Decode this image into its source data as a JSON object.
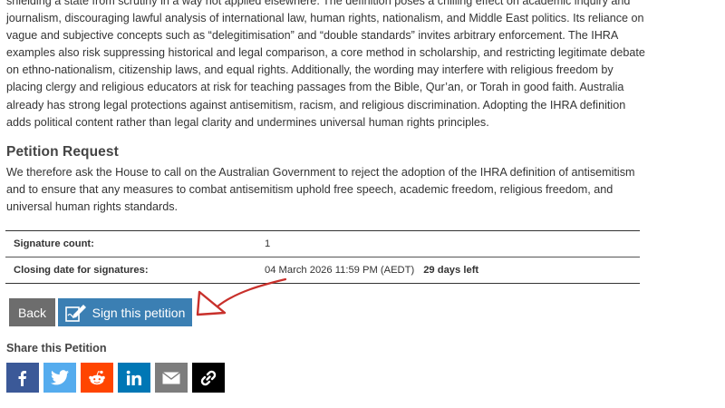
{
  "intro_paragraph": "shielding a state from scrutiny in a way not applied elsewhere. The definition poses a chilling effect on academic inquiry and journalism, discouraging lawful analysis of international law, human rights, nationalism, and Middle East politics. Its reliance on vague and subjective concepts such as “delegitimisation” and “double standards” invites arbitrary enforcement. The IHRA examples also risk suppressing historical and legal comparison, a core method in scholarship, and restricting legitimate debate on ethno-nationalism, citizenship laws, and equal rights. Additionally, the wording may interfere with religious freedom by placing clergy and religious educators at risk for teaching passages from the Bible, Qur’an, or Torah in good faith. Australia already has strong legal protections against antisemitism, racism, and religious discrimination. Adopting the IHRA definition adds political content rather than legal clarity and undermines universal human rights principles.",
  "petition_request": {
    "heading": "Petition Request",
    "text": "We therefore ask the House to call on the Australian Government to reject the adoption of the IHRA definition of antisemitism and to ensure that any measures to combat antisemitism uphold free speech, academic freedom, religious freedom, and universal human rights standards."
  },
  "details": {
    "signature_label": "Signature count:",
    "signature_value": "1",
    "closing_label": "Closing date for signatures:",
    "closing_value": "04 March 2026 11:59 PM (AEDT)",
    "days_left": "29 days left"
  },
  "buttons": {
    "back": "Back",
    "sign": "Sign this petition"
  },
  "share": {
    "heading": "Share this Petition",
    "items": [
      {
        "icon": "facebook-icon",
        "color": "#3b5998"
      },
      {
        "icon": "twitter-icon",
        "color": "#55acee"
      },
      {
        "icon": "reddit-icon",
        "color": "#ff4500"
      },
      {
        "icon": "linkedin-icon",
        "color": "#0077b5"
      },
      {
        "icon": "email-icon",
        "color": "#7d7d7d"
      },
      {
        "icon": "link-icon",
        "color": "#000000"
      }
    ]
  },
  "colors": {
    "sign_button": "#3b7fb3",
    "back_button": "#6d6d6d",
    "annotation_arrow": "#c8302b"
  }
}
